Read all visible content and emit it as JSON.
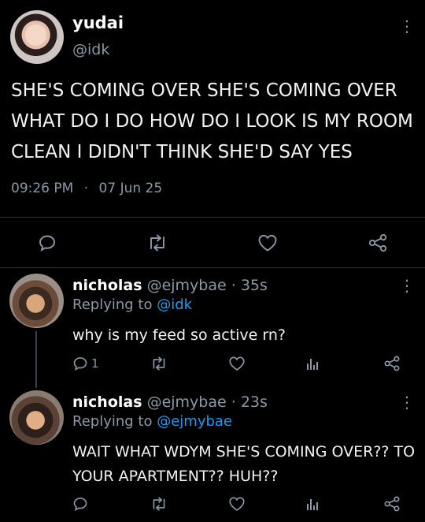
{
  "main_tweet": {
    "display_name": "yudai",
    "handle": "@idk",
    "text_lines": [
      "SHE'S COMING OVER SHE'S COMING OVER",
      "WHAT DO I DO HOW DO I LOOK IS MY ROOM",
      "CLEAN I DIDN'T THINK SHE'D SAY YES"
    ],
    "time": "09:26 PM",
    "separator": "·",
    "date": "07 Jun 25"
  },
  "replies": [
    {
      "display_name": "nicholas",
      "handle": "@ejmybae",
      "dot": "·",
      "age": "35s",
      "replying_prefix": "Replying to ",
      "replying_to": "@idk",
      "text_lines": [
        "why is my feed so active rn?"
      ],
      "reply_count": "1"
    },
    {
      "display_name": "nicholas",
      "handle": "@ejmybae",
      "dot": "·",
      "age": "23s",
      "replying_prefix": "Replying to ",
      "replying_to": "@ejmybae",
      "text_lines": [
        "WAIT WHAT WDYM SHE'S COMING OVER?? TO",
        "YOUR APARTMENT?? HUH??"
      ]
    }
  ],
  "more_glyph": "⋮",
  "colors": {
    "background": "#000000",
    "text": "#e7e9ea",
    "muted": "#8b98a5",
    "link": "#1d9bf0",
    "divider": "#2f3336"
  }
}
